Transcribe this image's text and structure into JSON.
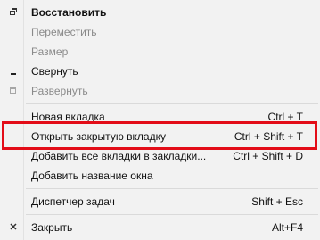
{
  "menu": {
    "restore": {
      "label": "Восстановить",
      "icon": "restore-icon"
    },
    "move": {
      "label": "Переместить"
    },
    "size": {
      "label": "Размер"
    },
    "minimize": {
      "label": "Свернуть",
      "icon": "minimize-icon"
    },
    "maximize": {
      "label": "Развернуть",
      "icon": "maximize-icon"
    },
    "new_tab": {
      "label": "Новая вкладка",
      "shortcut": "Ctrl + T"
    },
    "reopen_tab": {
      "label": "Открыть закрытую вкладку",
      "shortcut": "Ctrl + Shift + T"
    },
    "bookmark_all": {
      "label": "Добавить все вкладки в закладки...",
      "shortcut": "Ctrl + Shift + D"
    },
    "name_window": {
      "label": "Добавить название окна"
    },
    "task_manager": {
      "label": "Диспетчер задач",
      "shortcut": "Shift + Esc"
    },
    "close": {
      "label": "Закрыть",
      "shortcut": "Alt+F4",
      "icon": "close-icon"
    }
  },
  "colors": {
    "menu_background": "#f2f2f2",
    "highlight_border": "#e30d18",
    "disabled_text": "#8a8a8a"
  }
}
